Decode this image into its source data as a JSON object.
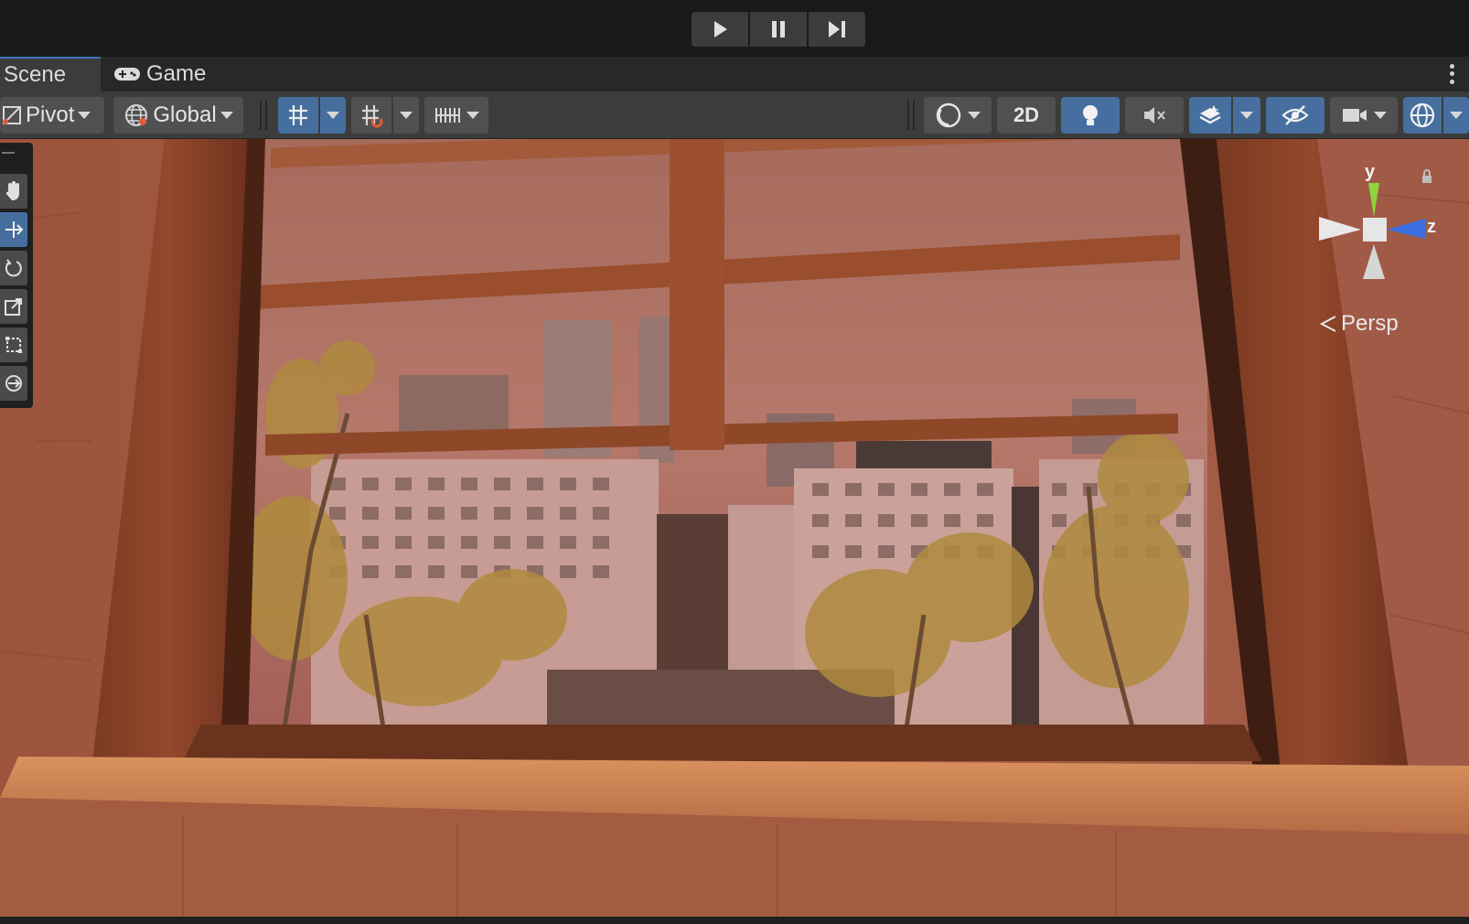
{
  "playbar": {
    "play_icon": "play-icon",
    "pause_icon": "pause-icon",
    "step_icon": "step-icon"
  },
  "tabs": [
    {
      "label": "Scene",
      "active": true
    },
    {
      "label": "Game",
      "icon": "gamepad-icon",
      "active": false
    }
  ],
  "toolbar": {
    "pivot_label": "Pivot",
    "global_label": "Global",
    "twod_label": "2D"
  },
  "tools": [
    "hand-icon",
    "move-icon",
    "rotate-icon",
    "scale-icon",
    "rect-icon",
    "transform-icon"
  ],
  "gizmo": {
    "y_label": "y",
    "z_label": "z",
    "projection_label": "Persp"
  },
  "colors": {
    "accent": "#466f9f",
    "toolbar": "#3c3c3c",
    "background": "#191919"
  }
}
